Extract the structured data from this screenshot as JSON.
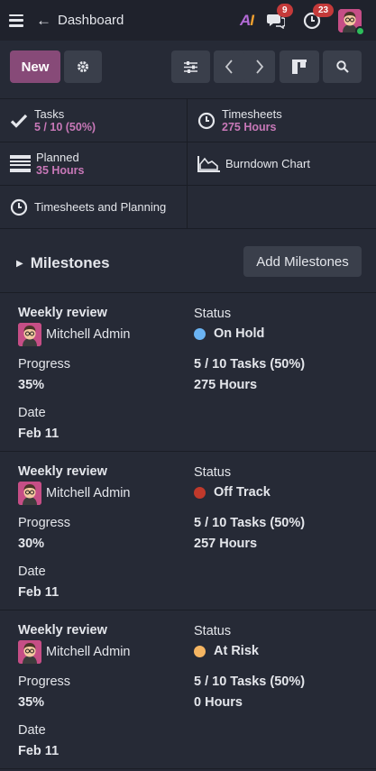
{
  "nav": {
    "breadcrumb": "Dashboard",
    "messages_badge": "9",
    "activities_badge": "23"
  },
  "toolbar": {
    "new_label": "New"
  },
  "stats": {
    "tasks": {
      "label": "Tasks",
      "value": "5 / 10 (50%)"
    },
    "timesheets": {
      "label": "Timesheets",
      "value": "275 Hours"
    },
    "planned": {
      "label": "Planned",
      "value": "35 Hours"
    },
    "burndown": {
      "label": "Burndown Chart"
    },
    "timesheets_planning": {
      "label": "Timesheets and Planning"
    }
  },
  "milestones": {
    "title": "Milestones",
    "add_label": "Add Milestones",
    "labels": {
      "status": "Status",
      "progress": "Progress",
      "date": "Date"
    },
    "items": [
      {
        "name": "Weekly review",
        "user": "Mitchell Admin",
        "status": "On Hold",
        "status_color": "#6ab3f3",
        "tasks": "5 / 10 Tasks (50%)",
        "hours": "275 Hours",
        "progress": "35%",
        "date": "Feb 11"
      },
      {
        "name": "Weekly review",
        "user": "Mitchell Admin",
        "status": "Off Track",
        "status_color": "#c0392b",
        "tasks": "5 / 10 Tasks (50%)",
        "hours": "257 Hours",
        "progress": "30%",
        "date": "Feb 11"
      },
      {
        "name": "Weekly review",
        "user": "Mitchell Admin",
        "status": "At Risk",
        "status_color": "#f5b562",
        "tasks": "5 / 10 Tasks (50%)",
        "hours": "0 Hours",
        "progress": "35%",
        "date": "Feb 11"
      }
    ]
  }
}
